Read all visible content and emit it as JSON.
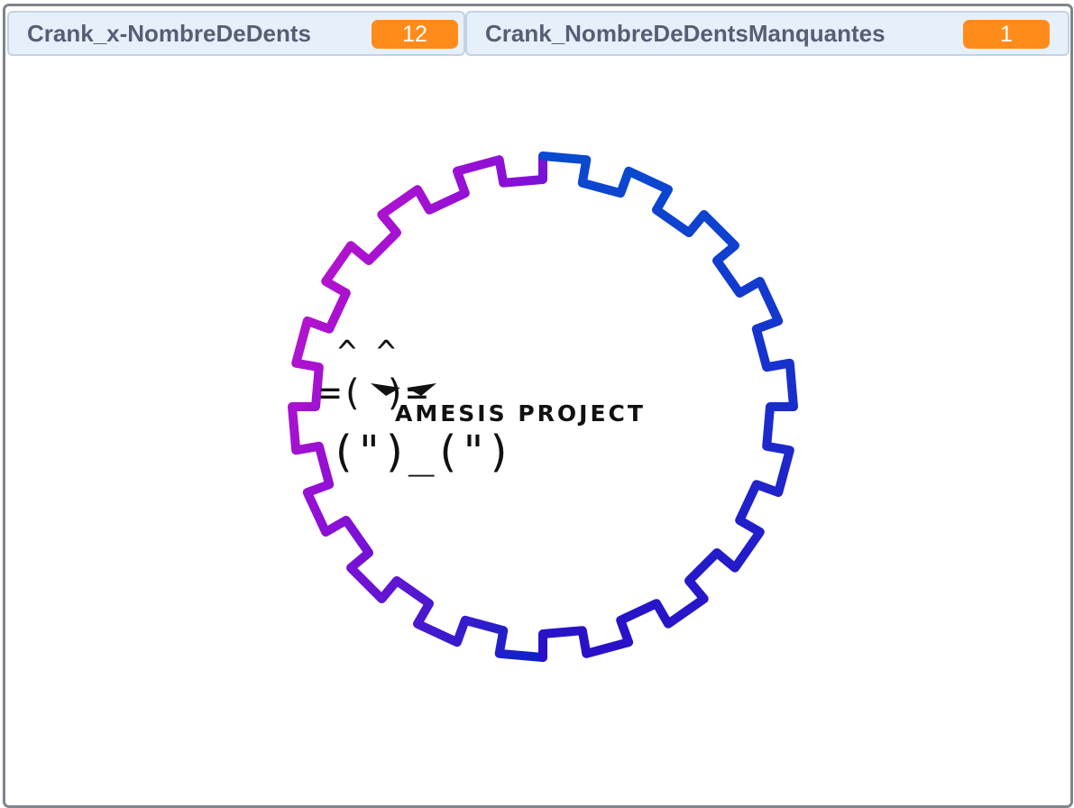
{
  "monitors": [
    {
      "label": "Crank_x-NombreDeDents",
      "value": "12"
    },
    {
      "label": "Crank_NombreDeDentsManquantes",
      "value": "1"
    }
  ],
  "colors": {
    "monitor_value_bg": "#ff8c1a",
    "monitor_bg": "#e6f0fb",
    "monitor_label": "#575e75",
    "gear_start": "#c212c6",
    "gear_mid": "#6a10d2",
    "gear_end": "#0a1fcc"
  },
  "gear": {
    "teeth": 12,
    "missing_teeth": 1
  },
  "logo": {
    "ears": "^  ^",
    "face": "=(     )=",
    "paws": "(\")_(\")",
    "brand": "AMESIS PROJECT"
  }
}
